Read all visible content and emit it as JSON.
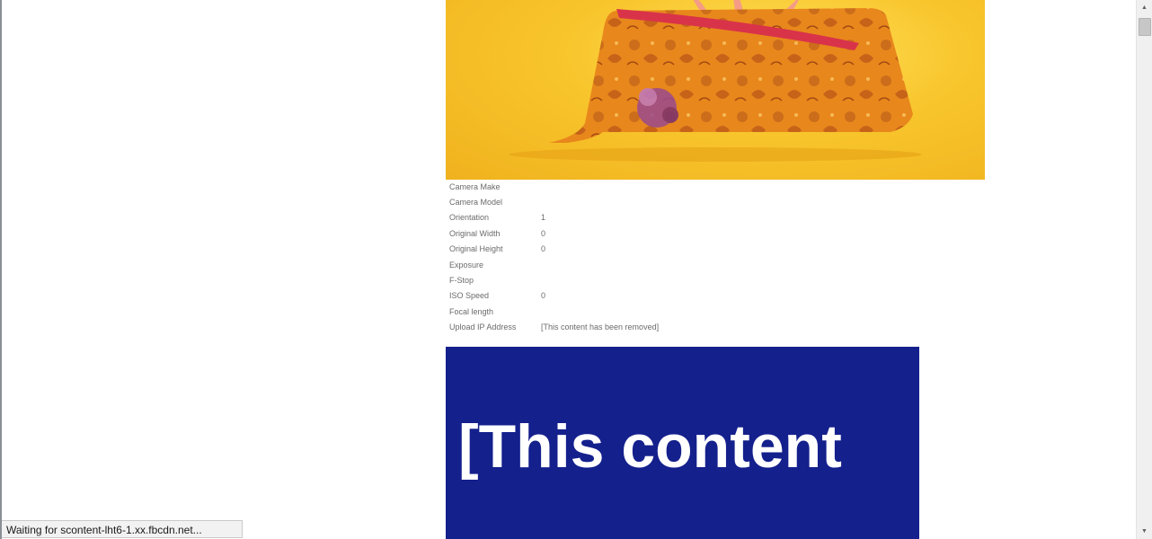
{
  "metadata": {
    "rows": [
      {
        "label": "Camera Make",
        "value": ""
      },
      {
        "label": "Camera Model",
        "value": ""
      },
      {
        "label": "Orientation",
        "value": "1"
      },
      {
        "label": "Original Width",
        "value": "0"
      },
      {
        "label": "Original Height",
        "value": "0"
      },
      {
        "label": "Exposure",
        "value": ""
      },
      {
        "label": "F-Stop",
        "value": ""
      },
      {
        "label": "ISO Speed",
        "value": "0"
      },
      {
        "label": "Focal length",
        "value": ""
      },
      {
        "label": "Upload IP Address",
        "value": "[This content has been removed]"
      }
    ]
  },
  "removed_image": {
    "text": "[This content",
    "bg_color": "#14208c"
  },
  "photo": {
    "subject": "orange brocade clutch purse with pink coral on yellow background"
  },
  "status_bar": {
    "text": "Waiting for scontent-lht6-1.xx.fbcdn.net..."
  },
  "scrollbar": {
    "up_icon": "triangle-up",
    "down_icon": "triangle-down"
  }
}
